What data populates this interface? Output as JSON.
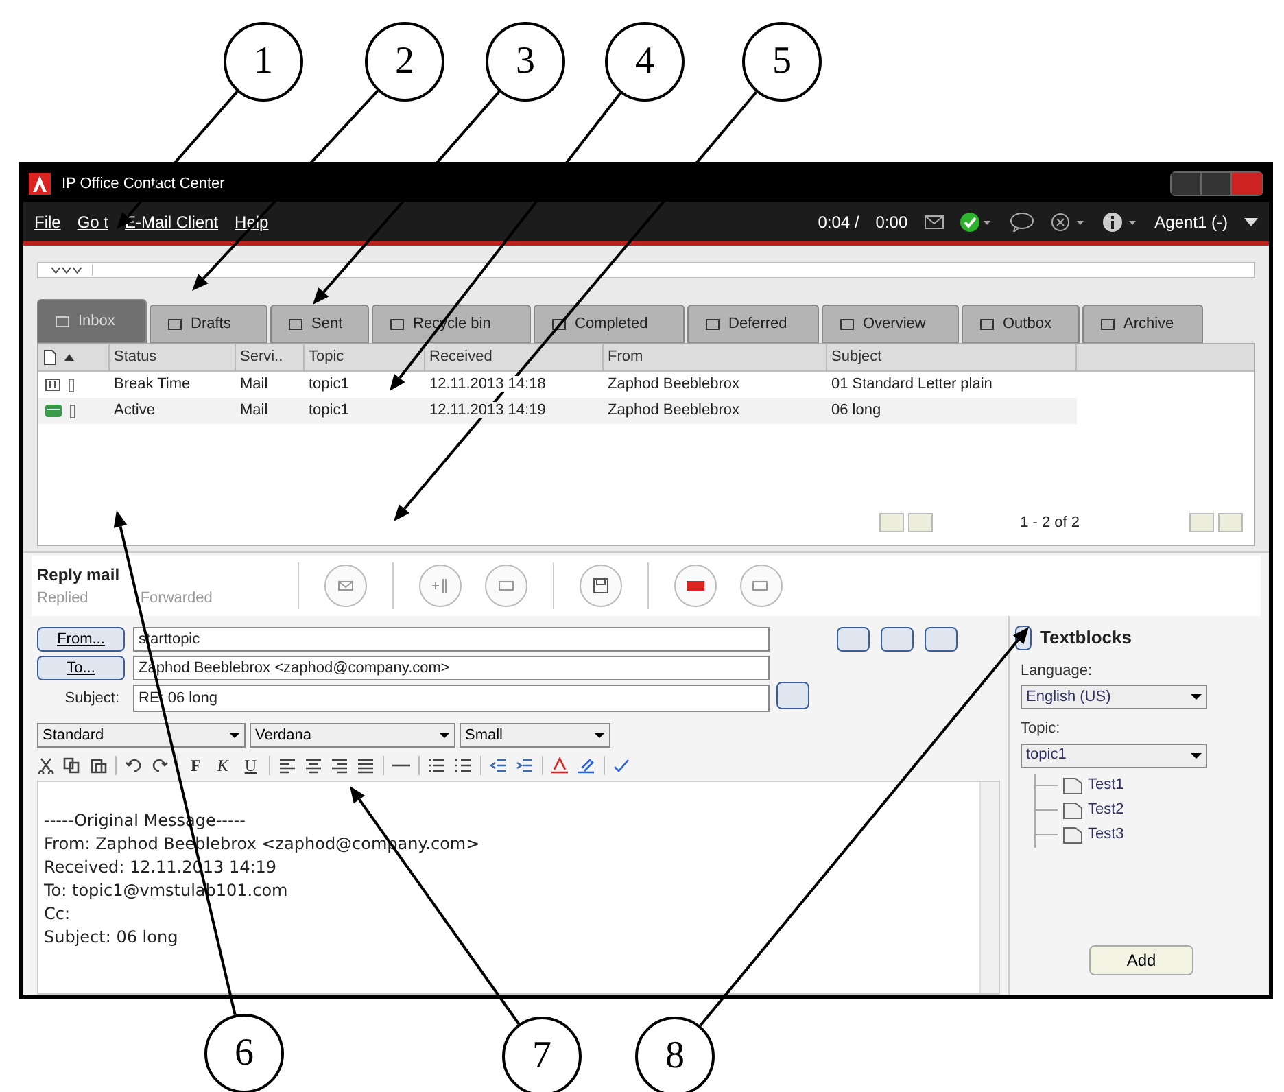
{
  "callouts": [
    {
      "label": "1"
    },
    {
      "label": "2"
    },
    {
      "label": "3"
    },
    {
      "label": "4"
    },
    {
      "label": "5"
    },
    {
      "label": "6"
    },
    {
      "label": "7"
    },
    {
      "label": "8"
    }
  ],
  "window": {
    "title": "IP Office Contact Center"
  },
  "menu": [
    "File",
    "Go t",
    "E-Mail Client",
    "Help"
  ],
  "status": {
    "timer": "0:04 /",
    "elapsed": "0:00",
    "agent": "Agent1 (-)"
  },
  "tabs": [
    {
      "label": "Inbox",
      "selected": true
    },
    {
      "label": "Drafts",
      "selected": false
    },
    {
      "label": "Sent",
      "selected": false
    },
    {
      "label": "Recycle bin",
      "selected": false
    },
    {
      "label": "Completed",
      "selected": false
    },
    {
      "label": "Deferred",
      "selected": false
    },
    {
      "label": "Overview",
      "selected": false
    },
    {
      "label": "Outbox",
      "selected": false
    },
    {
      "label": "Archive",
      "selected": false
    }
  ],
  "table": {
    "columns": [
      "Status",
      "Servi..",
      "Topic",
      "Received",
      "From",
      "Subject"
    ],
    "rows": [
      {
        "kind": "pause",
        "status": "Break Time",
        "service": "Mail",
        "topic": "topic1",
        "received": "12.11.2013 14:18",
        "from": "Zaphod Beeblebrox",
        "subject": "01 Standard Letter plain"
      },
      {
        "kind": "mail",
        "status": "Active",
        "service": "Mail",
        "topic": "topic1",
        "received": "12.11.2013 14:19",
        "from": "Zaphod Beeblebrox",
        "subject": "06 long"
      }
    ],
    "pager": "1 - 2 of 2"
  },
  "compose": {
    "title": "Reply mail",
    "flags": [
      "Replied",
      "Forwarded"
    ],
    "from": {
      "button": "From...",
      "value": "starttopic"
    },
    "to": {
      "button": "To...",
      "value": "Zaphod Beeblebrox <zaphod@company.com>"
    },
    "subject": {
      "label": "Subject:",
      "value": "RE: 06 long"
    },
    "dropdowns": [
      "Standard",
      "Verdana",
      "Small"
    ],
    "format_letters": [
      "F",
      "K",
      "U"
    ],
    "body": [
      "-----Original Message-----",
      "From: Zaphod Beeblebrox <zaphod@company.com>",
      "Received: 12.11.2013 14:19",
      "To: topic1@vmstulab101.com",
      "Cc:",
      "Subject: 06 long"
    ]
  },
  "textblocks": {
    "title": "Textblocks",
    "language_label": "Language:",
    "language": "English (US)",
    "topic_label": "Topic:",
    "topic": "topic1",
    "items": [
      "Test1",
      "Test2",
      "Test3"
    ],
    "add": "Add"
  }
}
